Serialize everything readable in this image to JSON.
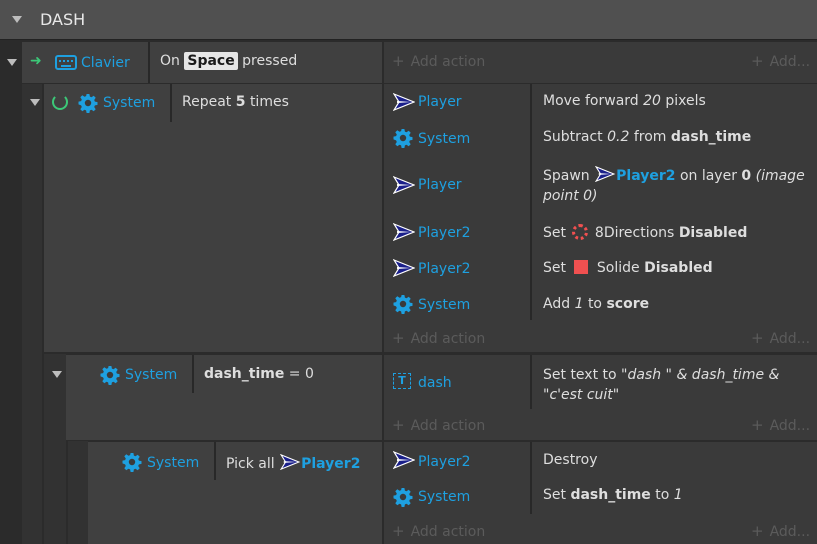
{
  "group": {
    "title": "DASH"
  },
  "add_action": "Add action",
  "add_more": "Add...",
  "events": {
    "e1": {
      "condition": {
        "object": "Clavier",
        "pre": "On",
        "key": "Space",
        "post": "pressed"
      }
    },
    "e2": {
      "condition": {
        "object": "System",
        "pre": "Repeat",
        "count": "5",
        "post": "times"
      },
      "actions": [
        {
          "object": "Player",
          "pre": "Move forward",
          "value": "20",
          "post": "pixels"
        },
        {
          "object": "System",
          "pre": "Subtract",
          "value": "0.2",
          "mid": "from",
          "var": "dash_time"
        },
        {
          "object": "Player",
          "pre": "Spawn",
          "target": "Player2",
          "mid": "on layer",
          "layer": "0",
          "post": "(image point 0)"
        },
        {
          "object": "Player2",
          "pre": "Set",
          "behavior": "8Directions",
          "state": "Disabled"
        },
        {
          "object": "Player2",
          "pre": "Set",
          "behavior": "Solide",
          "state": "Disabled"
        },
        {
          "object": "System",
          "pre": "Add",
          "value": "1",
          "mid": "to",
          "var": "score"
        }
      ]
    },
    "e3": {
      "condition": {
        "object": "System",
        "var": "dash_time",
        "op": "= 0"
      },
      "actions": [
        {
          "object": "dash",
          "pre": "Set text to",
          "expr": "\"dash \" & dash_time & \"c'est cuit\""
        }
      ]
    },
    "e4": {
      "condition": {
        "object": "System",
        "pre": "Pick all",
        "target": "Player2"
      },
      "actions": [
        {
          "object": "Player2",
          "text": "Destroy"
        },
        {
          "object": "System",
          "pre": "Set",
          "var": "dash_time",
          "mid": "to",
          "value": "1"
        }
      ]
    }
  },
  "colors": {
    "accent": "#1ea0e0",
    "background": "#2b2b2b",
    "row": "#3a3a3a",
    "condition": "#404040",
    "solide": "#f05050",
    "green": "#3cc878"
  }
}
